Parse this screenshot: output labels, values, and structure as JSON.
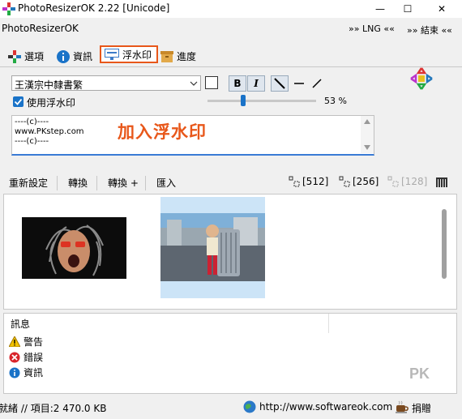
{
  "window": {
    "title": "PhotoResizerOK 2.22 [Unicode]",
    "min": "—",
    "max": "☐",
    "close": "✕"
  },
  "menubar": {
    "app_name": "PhotoResizerOK",
    "lng": "»» LNG ««",
    "exit": "»» 結束 ««"
  },
  "tabs": [
    {
      "label": "選項",
      "icon": "options-icon"
    },
    {
      "label": "資訊",
      "icon": "info-icon"
    },
    {
      "label": "浮水印",
      "icon": "watermark-icon",
      "active": true
    },
    {
      "label": "進度",
      "icon": "progress-icon"
    }
  ],
  "watermark": {
    "font_name": "王漢宗中隸書繁",
    "bold": "B",
    "italic": "I",
    "use_watermark_label": "使用浮水印",
    "use_watermark_checked": true,
    "opacity": "53 %",
    "opacity_value": 0.53,
    "text_lines": [
      "----(c)----",
      "www.PKstep.com",
      "----(c)----"
    ],
    "annotation": "加入浮水印"
  },
  "toolbar": {
    "reset": "重新設定",
    "convert": "轉換",
    "convert_plus": "轉換 +",
    "import": "匯入",
    "size_512": "[512]",
    "size_256": "[256]",
    "size_128": "[128]"
  },
  "messages": {
    "header": "訊息",
    "warning": "警告",
    "error": "錯誤",
    "info": "資訊"
  },
  "status": {
    "left": "就緒 // 項目:2 470.0 KB",
    "url": "http://www.softwareok.com",
    "donate": "捐贈"
  },
  "watermark_logo": "PK",
  "colors": {
    "accent": "#e8571a",
    "selection": "#cce4f7",
    "focus_border": "#3a7bd5"
  }
}
